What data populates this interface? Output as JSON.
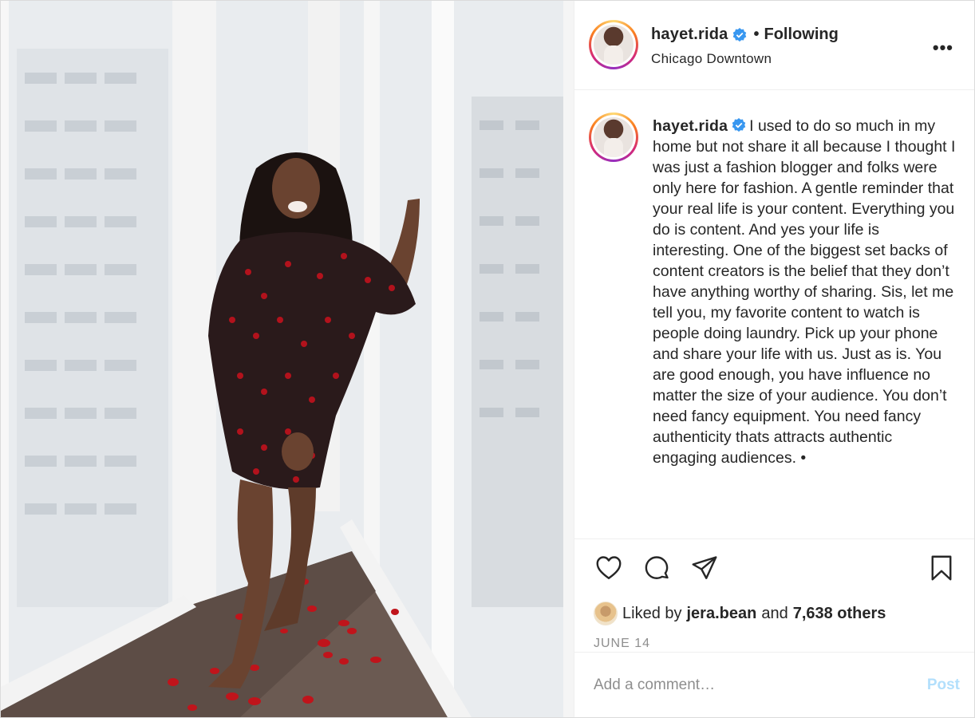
{
  "post": {
    "username": "hayet.rida",
    "verified": true,
    "separator": "•",
    "follow_status": "Following",
    "location": "Chicago Downtown",
    "more_icon": "more-horizontal-icon"
  },
  "caption": {
    "username": "hayet.rida",
    "text": "I used to do so much in my home but not share it all because I thought I was just a fashion blogger and folks were only here for fashion. A gentle reminder that your real life is your content. Everything you do is content. And yes your life is interesting. One of the biggest set backs of content creators is the belief that they don’t have anything worthy of sharing. Sis, let me tell you, my favorite content to watch is people doing laundry. Pick up your phone and share your life with us. Just as is. You are good enough, you have influence no matter the size of your audience. You don’t need fancy equipment. You need fancy authenticity thats attracts authentic engaging audiences. •"
  },
  "actions": {
    "icons": [
      "heart-icon",
      "comment-icon",
      "share-icon",
      "bookmark-icon"
    ]
  },
  "likes": {
    "prefix": "Liked by",
    "liked_by": "jera.bean",
    "and": "and",
    "others": "7,638 others"
  },
  "date": "JUNE 14",
  "comment": {
    "placeholder": "Add a comment…",
    "post_label": "Post"
  },
  "colors": {
    "verified_blue": "#3897f0",
    "post_disabled": "#b2dffc",
    "text": "#262626",
    "muted": "#8e8e8e"
  }
}
